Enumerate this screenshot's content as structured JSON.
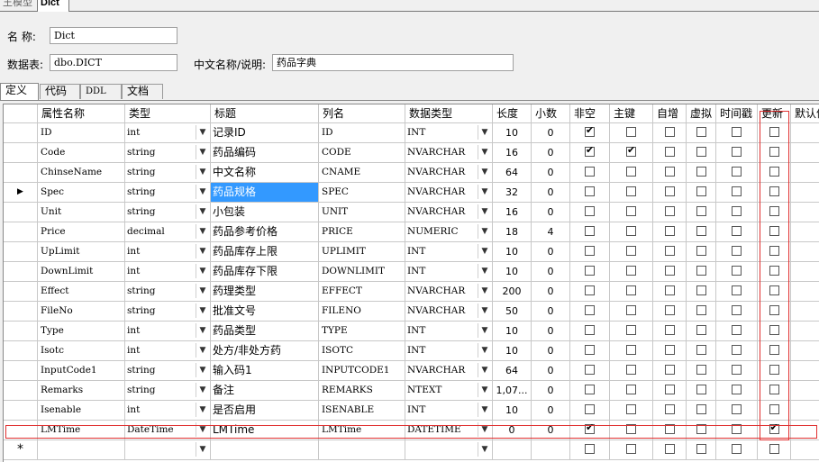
{
  "doc_tabs": [
    {
      "label": "王模型"
    },
    {
      "label": "Dict"
    }
  ],
  "form": {
    "name_label": "名 称:",
    "name_value": "Dict",
    "table_label": "数据表:",
    "table_value": "dbo.DICT",
    "cn_label": "中文名称/说明:",
    "cn_value": "药品字典"
  },
  "sub_tabs": [
    {
      "label": "定义"
    },
    {
      "label": "代码"
    },
    {
      "label": "DDL"
    },
    {
      "label": "文档"
    }
  ],
  "columns": [
    "属性名称",
    "类型",
    "标题",
    "列名",
    "数据类型",
    "长度",
    "小数",
    "非空",
    "主键",
    "自增",
    "虚拟",
    "时间戳",
    "更新",
    "默认值"
  ],
  "rows": [
    {
      "attr": "ID",
      "type": "int",
      "title": "记录ID",
      "col": "ID",
      "dtype": "INT",
      "len": "10",
      "dec": "0",
      "notnull": true,
      "pk": false,
      "auto": false,
      "virt": false,
      "ts": false,
      "upd": false
    },
    {
      "attr": "Code",
      "type": "string",
      "title": "药品编码",
      "col": "CODE",
      "dtype": "NVARCHAR",
      "len": "16",
      "dec": "0",
      "notnull": true,
      "pk": true,
      "auto": false,
      "virt": false,
      "ts": false,
      "upd": false
    },
    {
      "attr": "ChinseName",
      "type": "string",
      "title": "中文名称",
      "col": "CNAME",
      "dtype": "NVARCHAR",
      "len": "64",
      "dec": "0",
      "notnull": false,
      "pk": false,
      "auto": false,
      "virt": false,
      "ts": false,
      "upd": false
    },
    {
      "attr": "Spec",
      "type": "string",
      "title": "药品规格",
      "col": "SPEC",
      "dtype": "NVARCHAR",
      "len": "32",
      "dec": "0",
      "notnull": false,
      "pk": false,
      "auto": false,
      "virt": false,
      "ts": false,
      "upd": false
    },
    {
      "attr": "Unit",
      "type": "string",
      "title": "小包装",
      "col": "UNIT",
      "dtype": "NVARCHAR",
      "len": "16",
      "dec": "0",
      "notnull": false,
      "pk": false,
      "auto": false,
      "virt": false,
      "ts": false,
      "upd": false
    },
    {
      "attr": "Price",
      "type": "decimal",
      "title": "药品参考价格",
      "col": "PRICE",
      "dtype": "NUMERIC",
      "len": "18",
      "dec": "4",
      "notnull": false,
      "pk": false,
      "auto": false,
      "virt": false,
      "ts": false,
      "upd": false
    },
    {
      "attr": "UpLimit",
      "type": "int",
      "title": "药品库存上限",
      "col": "UPLIMIT",
      "dtype": "INT",
      "len": "10",
      "dec": "0",
      "notnull": false,
      "pk": false,
      "auto": false,
      "virt": false,
      "ts": false,
      "upd": false
    },
    {
      "attr": "DownLimit",
      "type": "int",
      "title": "药品库存下限",
      "col": "DOWNLIMIT",
      "dtype": "INT",
      "len": "10",
      "dec": "0",
      "notnull": false,
      "pk": false,
      "auto": false,
      "virt": false,
      "ts": false,
      "upd": false
    },
    {
      "attr": "Effect",
      "type": "string",
      "title": "药理类型",
      "col": "EFFECT",
      "dtype": "NVARCHAR",
      "len": "200",
      "dec": "0",
      "notnull": false,
      "pk": false,
      "auto": false,
      "virt": false,
      "ts": false,
      "upd": false
    },
    {
      "attr": "FileNo",
      "type": "string",
      "title": "批准文号",
      "col": "FILENO",
      "dtype": "NVARCHAR",
      "len": "50",
      "dec": "0",
      "notnull": false,
      "pk": false,
      "auto": false,
      "virt": false,
      "ts": false,
      "upd": false
    },
    {
      "attr": "Type",
      "type": "int",
      "title": "药品类型",
      "col": "TYPE",
      "dtype": "INT",
      "len": "10",
      "dec": "0",
      "notnull": false,
      "pk": false,
      "auto": false,
      "virt": false,
      "ts": false,
      "upd": false
    },
    {
      "attr": "Isotc",
      "type": "int",
      "title": "处方/非处方药",
      "col": "ISOTC",
      "dtype": "INT",
      "len": "10",
      "dec": "0",
      "notnull": false,
      "pk": false,
      "auto": false,
      "virt": false,
      "ts": false,
      "upd": false
    },
    {
      "attr": "InputCode1",
      "type": "string",
      "title": "输入码1",
      "col": "INPUTCODE1",
      "dtype": "NVARCHAR",
      "len": "64",
      "dec": "0",
      "notnull": false,
      "pk": false,
      "auto": false,
      "virt": false,
      "ts": false,
      "upd": false
    },
    {
      "attr": "Remarks",
      "type": "string",
      "title": "备注",
      "col": "REMARKS",
      "dtype": "NTEXT",
      "len": "1,07...",
      "dec": "0",
      "notnull": false,
      "pk": false,
      "auto": false,
      "virt": false,
      "ts": false,
      "upd": false
    },
    {
      "attr": "Isenable",
      "type": "int",
      "title": "是否启用",
      "col": "ISENABLE",
      "dtype": "INT",
      "len": "10",
      "dec": "0",
      "notnull": false,
      "pk": false,
      "auto": false,
      "virt": false,
      "ts": false,
      "upd": false
    },
    {
      "attr": "LMTime",
      "type": "DateTime",
      "title": "LMTime",
      "col": "LMTime",
      "dtype": "DATETIME",
      "len": "0",
      "dec": "0",
      "notnull": true,
      "pk": false,
      "auto": false,
      "virt": false,
      "ts": false,
      "upd": true
    }
  ],
  "current_row_index": 3,
  "new_row_marker": "*",
  "current_row_marker": "▶",
  "dropdown_glyph": "▼",
  "colors": {
    "selection": "#3399ff",
    "highlight_border": "#e03030"
  }
}
